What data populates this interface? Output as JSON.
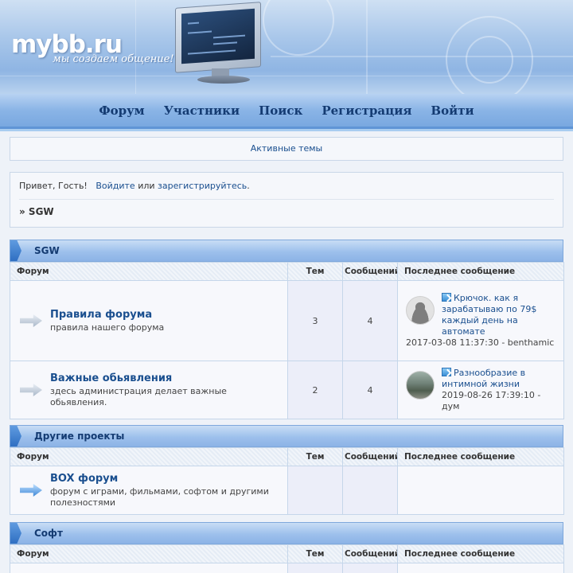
{
  "brand": {
    "logo": "mybb.ru",
    "slogan": "мы создаем общение!"
  },
  "nav": {
    "items": [
      "Форум",
      "Участники",
      "Поиск",
      "Регистрация",
      "Войти"
    ]
  },
  "active_topics": "Активные темы",
  "welcome": {
    "greeting": "Привет, Гость!",
    "login": "Войдите",
    "or": "или",
    "register": "зарегистрируйтесь",
    "breadcrumb": "» SGW"
  },
  "table_headers": {
    "forum": "Форум",
    "topics": "Тем",
    "posts": "Сообщений",
    "last_post": "Последнее сообщение"
  },
  "categories": [
    {
      "title": "SGW",
      "forums": [
        {
          "name": "Правила форума",
          "desc": "правила нашего форума",
          "topics": "3",
          "posts": "4",
          "last_title": "Крючок. как я зарабатываю по 79$ каждый день на автомате",
          "last_meta": "2017-03-08 11:37:30 - benthamic"
        },
        {
          "name": "Важные обьявления",
          "desc": "здесь администрация делает важные обьявления.",
          "topics": "2",
          "posts": "4",
          "last_title": "Разнообразие в интимной жизни",
          "last_meta": "2019-08-26 17:39:10 - дум"
        }
      ]
    },
    {
      "title": "Другие проекты",
      "forums": [
        {
          "name": "BOX форум",
          "desc": "форум с играми, фильмами, софтом и другими полезностями",
          "topics": "",
          "posts": "",
          "last_title": "",
          "last_meta": ""
        }
      ]
    },
    {
      "title": "Софт",
      "forums": []
    }
  ],
  "colors": {
    "link": "#1a4f8f",
    "nav_text": "#143b72",
    "header_blue": "#8ab4e6"
  }
}
